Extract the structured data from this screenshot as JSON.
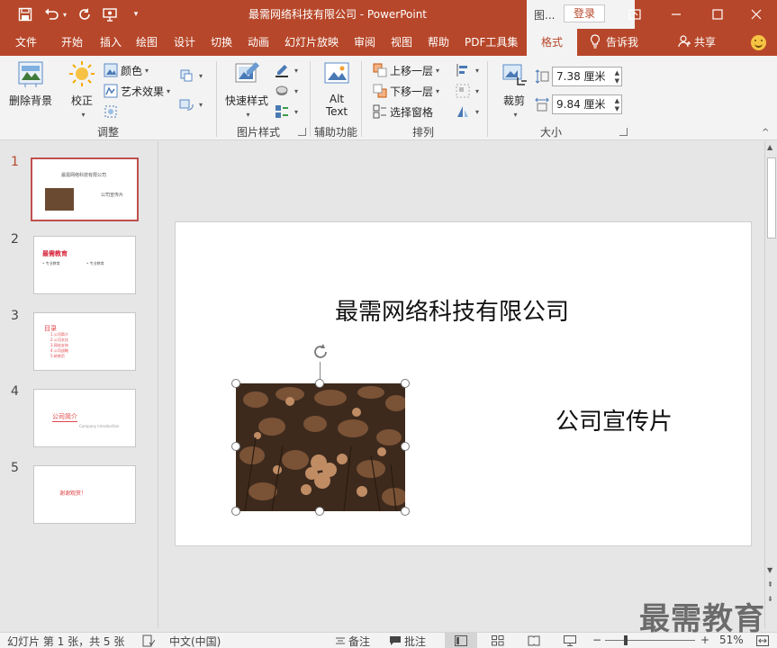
{
  "window": {
    "title": "最需网络科技有限公司  -  PowerPoint",
    "context_tools_label": "图...",
    "login_label": "登录"
  },
  "tabs": [
    {
      "label": "文件",
      "active": false
    },
    {
      "label": "开始",
      "active": false
    },
    {
      "label": "插入",
      "active": false
    },
    {
      "label": "绘图",
      "active": false
    },
    {
      "label": "设计",
      "active": false
    },
    {
      "label": "切换",
      "active": false
    },
    {
      "label": "动画",
      "active": false
    },
    {
      "label": "幻灯片放映",
      "active": false
    },
    {
      "label": "审阅",
      "active": false
    },
    {
      "label": "视图",
      "active": false
    },
    {
      "label": "帮助",
      "active": false
    },
    {
      "label": "PDF工具集",
      "active": false
    },
    {
      "label": "格式",
      "active": true
    }
  ],
  "tell_me": "告诉我",
  "share": "共享",
  "ribbon": {
    "adjust": {
      "label": "调整",
      "remove_bg": "删除背景",
      "corrections": "校正",
      "color": "颜色",
      "artistic": "艺术效果"
    },
    "styles": {
      "label": "图片样式",
      "quick_styles": "快速样式"
    },
    "accessibility": {
      "label": "辅助功能",
      "alt_text_1": "Alt",
      "alt_text_2": "Text"
    },
    "arrange": {
      "label": "排列",
      "bring_forward": "上移一层",
      "send_backward": "下移一层",
      "selection_pane": "选择窗格"
    },
    "size": {
      "label": "大小",
      "crop": "裁剪",
      "height": "7.38 厘米",
      "width": "9.84 厘米"
    }
  },
  "slides": [
    {
      "num": "1",
      "title": "最需网络科技有限公司",
      "subtitle": "公司宣传片"
    },
    {
      "num": "2",
      "title": "最需教育",
      "b1": "• 专业教育",
      "b2": "• 专业教育"
    },
    {
      "num": "3",
      "title": "目录",
      "items": [
        "1.公司简介",
        "2.公司文化",
        "3.网站支持",
        "4.公司战略",
        "5.结束页"
      ]
    },
    {
      "num": "4",
      "title": "公司简介",
      "subtitle": "Company introduction"
    },
    {
      "num": "5",
      "title": "谢谢观赏！"
    }
  ],
  "current_slide": {
    "title": "最需网络科技有限公司",
    "subtitle": "公司宣传片"
  },
  "status": {
    "slide_info": "幻灯片 第 1 张，共 5 张",
    "language": "中文(中国)",
    "notes": "备注",
    "comments": "批注",
    "zoom": "51%",
    "zoom_level": 0.51
  },
  "watermark": "最需教育",
  "colors": {
    "accent": "#b7472a",
    "ribbon_bg": "#f3f3f3",
    "selected_thumb_border": "#c0504d"
  }
}
